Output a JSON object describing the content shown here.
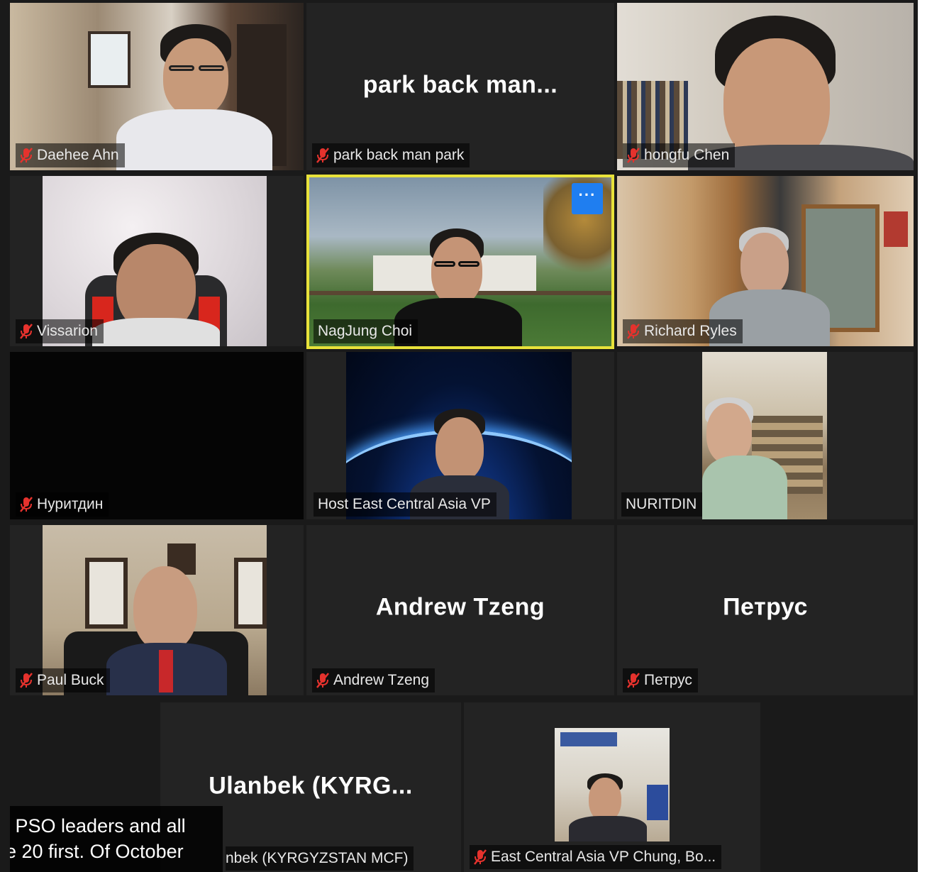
{
  "participants": [
    {
      "name": "Daehee Ahn",
      "muted": true
    },
    {
      "name": "park back man park",
      "display": "park back man...",
      "muted": true
    },
    {
      "name": "hongfu Chen",
      "muted": true
    },
    {
      "name": "Vissarion",
      "muted": true
    },
    {
      "name": "NagJung Choi",
      "muted": false,
      "active_speaker": true
    },
    {
      "name": "Richard Ryles",
      "muted": true
    },
    {
      "name": "Нуритдин",
      "muted": true
    },
    {
      "name": "Host East Central Asia VP",
      "muted": false
    },
    {
      "name": "NURITDIN",
      "muted": false
    },
    {
      "name": "Paul Buck",
      "muted": true
    },
    {
      "name": "Andrew Tzeng",
      "display": "Andrew Tzeng",
      "muted": true
    },
    {
      "name": "Петрус",
      "display": "Петрус",
      "muted": true
    },
    {
      "name": "Ulanbek (KYRGYZSTAN MCF)",
      "display": "Ulanbek  (KYRG...",
      "plate": "nbek (KYRGYZSTAN MCF)",
      "muted": false
    },
    {
      "name": "East Central Asia VP Chung, Bo...",
      "muted": true
    }
  ],
  "more_button": {
    "label": "···"
  },
  "caption": {
    "lines": [
      "l PSO leaders and all",
      "e 20 first. Of October"
    ]
  },
  "colors": {
    "active_border": "#e8e23a",
    "more_button": "#1f7ef0",
    "muted_icon": "#e5322d"
  }
}
